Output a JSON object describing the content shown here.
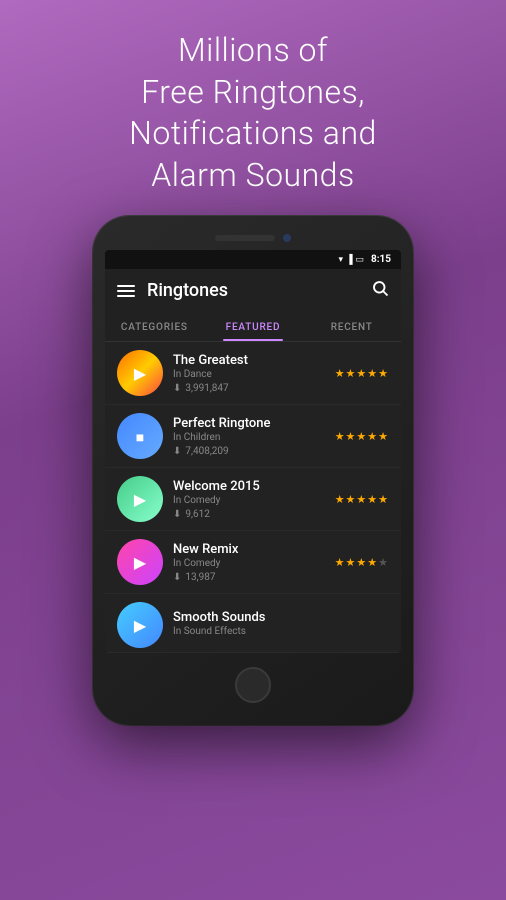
{
  "hero": {
    "line1": "Millions of",
    "line2": "Free Ringtones,",
    "line3": "Notifications and",
    "line4": "Alarm Sounds"
  },
  "status_bar": {
    "time": "8:15"
  },
  "header": {
    "title": "Ringtones",
    "menu_icon": "☰",
    "search_icon": "🔍"
  },
  "tabs": [
    {
      "id": "categories",
      "label": "CATEGORIES",
      "active": false
    },
    {
      "id": "featured",
      "label": "FEATURED",
      "active": true
    },
    {
      "id": "recent",
      "label": "RECENT",
      "active": false
    }
  ],
  "ringtones": [
    {
      "name": "The Greatest",
      "category": "In Dance",
      "downloads": "3,991,847",
      "stars": 5,
      "thumb_class": "thumb-dance",
      "icon_class": "play-icon"
    },
    {
      "name": "Perfect Ringtone",
      "category": "In Children",
      "downloads": "7,408,209",
      "stars": 5,
      "thumb_class": "thumb-children",
      "icon_class": "stop-icon"
    },
    {
      "name": "Welcome 2015",
      "category": "In Comedy",
      "downloads": "9,612",
      "stars": 5,
      "thumb_class": "thumb-comedy",
      "icon_class": "play-icon"
    },
    {
      "name": "New Remix",
      "category": "In Comedy",
      "downloads": "13,987",
      "stars": 4,
      "thumb_class": "thumb-remix",
      "icon_class": "play-icon"
    },
    {
      "name": "Smooth Sounds",
      "category": "In Sound Effects",
      "downloads": "",
      "stars": 0,
      "thumb_class": "thumb-smooth",
      "icon_class": "play-icon"
    }
  ]
}
